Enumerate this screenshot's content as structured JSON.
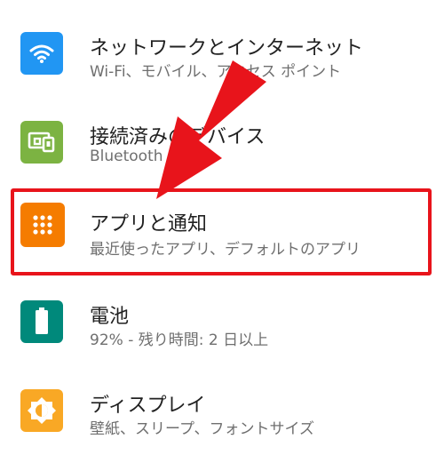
{
  "settings": [
    {
      "title": "ネットワークとインターネット",
      "subtitle": "Wi-Fi、モバイル、アクセス ポイント",
      "icon": "wifi-icon",
      "color": "#2196f3"
    },
    {
      "title": "接続済みのデバイス",
      "subtitle": "Bluetooth",
      "icon": "devices-icon",
      "color": "#7cb342"
    },
    {
      "title": "アプリと通知",
      "subtitle": "最近使ったアプリ、デフォルトのアプリ",
      "icon": "apps-icon",
      "color": "#f57c00"
    },
    {
      "title": "電池",
      "subtitle": "92% - 残り時間: 2 日以上",
      "icon": "battery-icon",
      "color": "#00897b"
    },
    {
      "title": "ディスプレイ",
      "subtitle": "壁紙、スリープ、フォントサイズ",
      "icon": "brightness-icon",
      "color": "#f9a825"
    }
  ],
  "annotation": {
    "color": "#e8141b"
  }
}
